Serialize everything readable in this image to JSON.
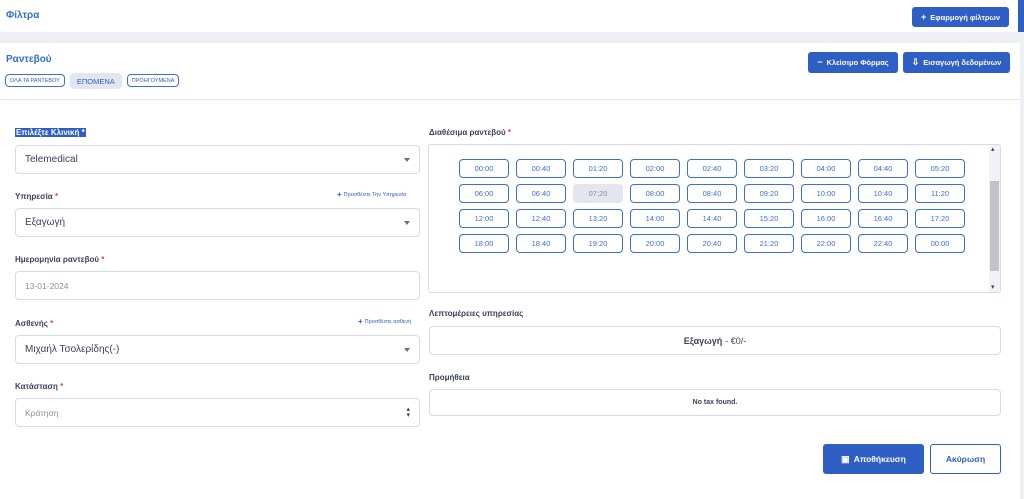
{
  "filters": {
    "title": "Φίλτρα",
    "apply_button": "Εφαρμογή φίλτρων"
  },
  "appointments": {
    "title": "Ραντεβού",
    "tabs": [
      "ΟΛΑ ΤΑ ΡΑΝΤΕΒΟΥ",
      "ΕΠΟΜΕΝΑ",
      "ΠΡΟΗΓΟΥΜΕΝΑ"
    ],
    "active_tab": "ΕΠΟΜΕΝΑ",
    "close_form_button": "Κλείσιμο Φόρμας",
    "import_button": "Εισαγωγή δεδομένων"
  },
  "form": {
    "clinic": {
      "label": "Επιλέξτε Κλινική",
      "value": "Telemedical"
    },
    "service": {
      "label": "Υπηρεσία",
      "value": "Εξαγωγή",
      "add_link": "Προσθέστε Την Υπηρεσία"
    },
    "date": {
      "label": "Ημερομηνία ραντεβού",
      "value": "13-01-2024"
    },
    "patient": {
      "label": "Ασθενής",
      "value": "Μιχαήλ Τσολερίδης(-)",
      "add_link": "Προσθέστε ασθενή"
    },
    "status": {
      "label": "Κατάσταση",
      "value": "Κράτηση"
    },
    "required_mark": "*"
  },
  "slots": {
    "label": "Διαθέσιμα ραντεβού",
    "times": [
      "00:00",
      "00:40",
      "01:20",
      "02:00",
      "02:40",
      "03:20",
      "04:00",
      "04:40",
      "05:20",
      "06:00",
      "06:40",
      "07:20",
      "08:00",
      "08:40",
      "09:20",
      "10:00",
      "10:40",
      "11:20",
      "12:00",
      "12:40",
      "13:20",
      "14:00",
      "14:40",
      "15:20",
      "16:00",
      "16:40",
      "17:20",
      "18:00",
      "18:40",
      "19:20",
      "20:00",
      "20:40",
      "21:20",
      "22:00",
      "22:40",
      "00:00"
    ],
    "disabled": [
      "07:20"
    ]
  },
  "service_details": {
    "label": "Λεπτομέρειες υπηρεσίας",
    "name": "Εξαγωγή",
    "price": " - €0/-"
  },
  "commission": {
    "label": "Προμήθεια",
    "value": "No tax found."
  },
  "actions": {
    "save": "Αποθήκευση",
    "cancel": "Ακύρωση"
  },
  "colors": {
    "primary": "#2f5fc4",
    "required": "#e04545",
    "border": "#d8dbe4"
  },
  "icons": {
    "plus": "plus-icon",
    "minus": "minus-icon",
    "import": "import-icon",
    "save": "floppy-icon",
    "caret": "chevron-down-icon"
  }
}
